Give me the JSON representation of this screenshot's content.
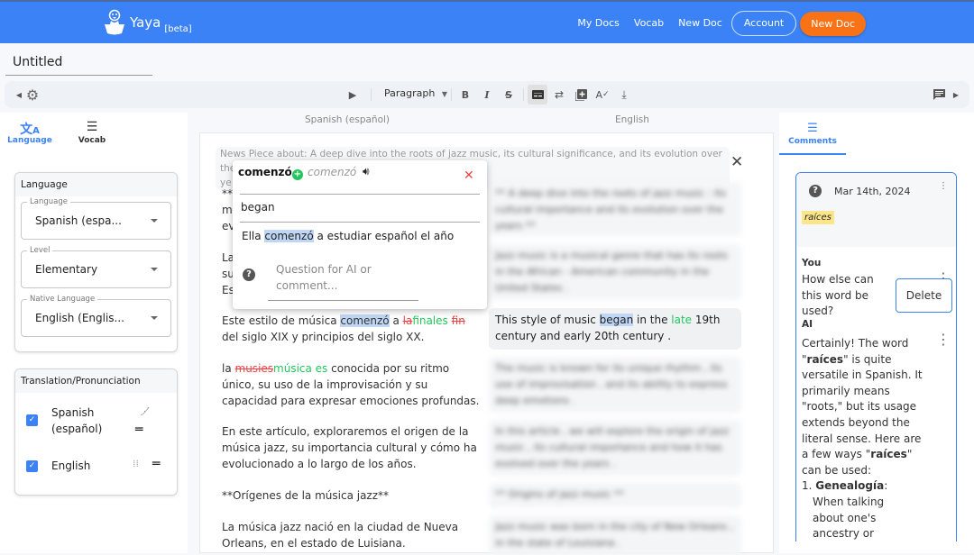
{
  "header": {
    "app_name": "Yaya",
    "beta_label": "[beta]",
    "nav": [
      "My Docs",
      "Vocab",
      "New Doc"
    ],
    "account_label": "Account",
    "new_doc_button": "New Doc",
    "brand_color": "#3b82f6",
    "accent_color": "#f97316"
  },
  "document": {
    "title": "Untitled"
  },
  "toolbar": {
    "paragraph_select": "Paragraph",
    "bold": "B",
    "italic": "I",
    "strike": "S"
  },
  "left_panel": {
    "tabs": [
      {
        "label": "Language",
        "icon": "translate-icon",
        "active": true
      },
      {
        "label": "Vocab",
        "icon": "list-icon",
        "active": false
      }
    ],
    "language_card": {
      "title": "Language",
      "fields": [
        {
          "label": "Language",
          "value": "Spanish (espa..."
        },
        {
          "label": "Level",
          "value": "Elementary"
        },
        {
          "label": "Native Language",
          "value": "English (Englis..."
        }
      ]
    },
    "translation_card": {
      "title": "Translation/Pronunciation",
      "items": [
        {
          "label": "Spanish (español)",
          "line1": "Spanish",
          "line2": "(español)",
          "checked": true
        },
        {
          "label": "English",
          "checked": true
        }
      ]
    }
  },
  "editor": {
    "source_column": "Spanish (español)",
    "target_column": "English",
    "news_prompt": "News Piece about: A deep dive into the roots of jazz music, its cultural significance, and its evolution over the years",
    "news_prompt_line1": "News Piece about: A deep dive into the roots of jazz music, its cultural significance, and its evolution over the",
    "news_prompt_line2": "ye",
    "paragraphs": [
      {
        "es_parts": [
          "**U",
          "m",
          "ev"
        ],
        "en": "** A deep dive into the roots of jazz music : its cultural importance and its evolution over the years **"
      },
      {
        "es_parts": [
          "La",
          "su",
          "Es"
        ],
        "en": "Jazz music is a musical genre that has its roots in the African - American community in the United States ."
      },
      {
        "es_pre": "Este estilo de música ",
        "es_hl": "comenzó",
        "es_mid": " a ",
        "es_del1": "la",
        "es_ins1": "finales",
        "es_sp": " ",
        "es_del2": "fin ",
        "es_post": "del siglo XIX y principios del siglo XX.",
        "en_pre": "This style of music ",
        "en_hl": "began",
        "en_mid": " in the ",
        "en_ins": "late",
        "en_post": " 19th century and early 20th century ."
      },
      {
        "es_pre": "la ",
        "es_del": "musies",
        "es_ins": "música es",
        "es_post": " conocida por su ritmo único, su uso de la improvisación y su capacidad para expresar emociones profundas.",
        "en": "The music is known for its unique rhythm , its use of improvisation , and its ability to express deep emotions ."
      },
      {
        "es": "En este artículo, exploraremos el origen de la música jazz, su importancia cultural y cómo ha evolucionado a lo largo de los años.",
        "en": "In this article , we will explore the origin of jazz music , its cultural importance and how it has evolved over the years ."
      },
      {
        "es": "**Orígenes de la música jazz**",
        "en": "** Origins of jazz music **"
      },
      {
        "es": "La música jazz nació en la ciudad de Nueva Orleans, en el estado de Luisiana.",
        "en": "Jazz music was born in the city of New Orleans , in the state of Louisiana ."
      }
    ]
  },
  "word_popup": {
    "word": "comenzó",
    "pronunciation": "comenzó",
    "translation": "began",
    "example_pre": "Ella ",
    "example_hl": "comenzó",
    "example_post": " a estudiar español el año",
    "comment_placeholder": "Question for AI or comment..."
  },
  "right_panel": {
    "tab_label": "Comments",
    "comment": {
      "date": "Mar 14th, 2024",
      "tag": "raíces",
      "you_label": "You",
      "question": "How else can this word be used?",
      "delete_label": "Delete",
      "ai_label": "AI",
      "ai_intro": "Certainly! The word",
      "ai_word": "raíces",
      "ai_p1": " is quite versatile in Spanish. It primarily means \"roots,\" but its usage extends beyond the literal sense. Here are a few ways ",
      "ai_p2": " can be used:",
      "ai_list_1_title": "Genealogía",
      "ai_list_1_text": "When talking about one's ancestry or family origins"
    }
  }
}
